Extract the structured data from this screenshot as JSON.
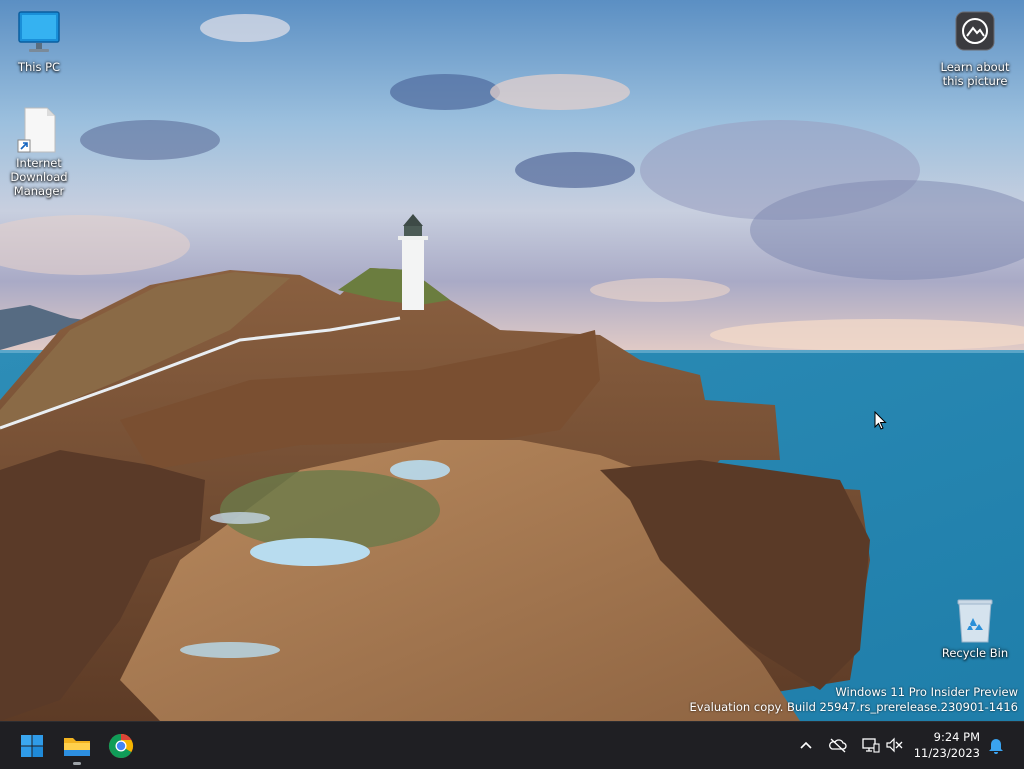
{
  "desktop": {
    "icons": [
      {
        "label": "This PC"
      },
      {
        "label": "Internet Download Manager"
      },
      {
        "label": "Learn about this picture"
      },
      {
        "label": "Recycle Bin"
      }
    ],
    "watermark": {
      "line1": "Windows 11 Pro Insider Preview",
      "line2": "Evaluation copy. Build 25947.rs_prerelease.230901-1416"
    }
  },
  "taskbar": {
    "apps": [
      {
        "icon": "windows-start-icon"
      },
      {
        "icon": "file-explorer-icon"
      },
      {
        "icon": "chrome-icon"
      }
    ],
    "tray": {
      "icons": [
        "chevron-up-icon",
        "onedrive-offline-icon",
        "network-icon",
        "volume-muted-icon",
        "notification-bell-icon"
      ]
    },
    "clock": {
      "time": "9:24 PM",
      "date": "11/23/2023"
    }
  },
  "colors": {
    "taskbar_bg": "#1f1f23",
    "accent_blue": "#0a84d6"
  }
}
